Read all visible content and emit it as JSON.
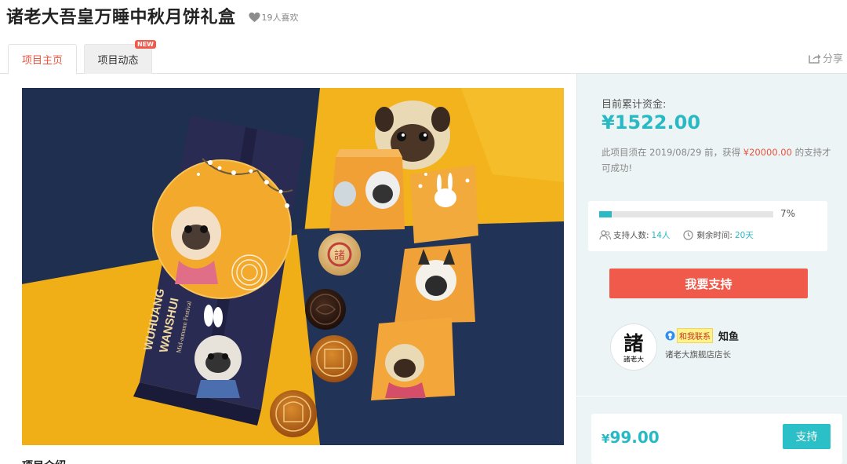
{
  "header": {
    "title": "诸老大吾皇万睡中秋月饼礼盒",
    "likes": "19人喜欢"
  },
  "tabs": {
    "home": "项目主页",
    "updates": "项目动态",
    "new_badge": "NEW",
    "share": "分享"
  },
  "main": {
    "intro_heading": "项目介绍"
  },
  "box_text": {
    "brand1": "WUHUANG",
    "brand2": "WANSHUI",
    "sub": "Mid-autumn Festival",
    "seal": "諸"
  },
  "funding": {
    "label": "目前累计资金:",
    "amount": "¥1522.00",
    "note_prefix": "此项目须在 2019/08/29 前，获得 ",
    "goal": "¥20000.00",
    "note_suffix": " 的支持才可成功!",
    "progress_percent": 7,
    "progress_label": "7%",
    "supporters_label": "支持人数:",
    "supporters_value": "14人",
    "time_left_label": "剩余时间:",
    "time_left_value": "20天"
  },
  "support_button": "我要支持",
  "creator": {
    "avatar_text_top": "諸",
    "avatar_text_bottom": "諸老大",
    "contact_label": "和我联系",
    "name": "知鱼",
    "role": "诸老大旗舰店店长"
  },
  "reward": {
    "currency": "¥",
    "price": "99.00",
    "button": "支持"
  },
  "colors": {
    "accent_teal": "#27b9c4",
    "accent_red": "#f05a4a",
    "panel_bg": "#edf4f5"
  }
}
